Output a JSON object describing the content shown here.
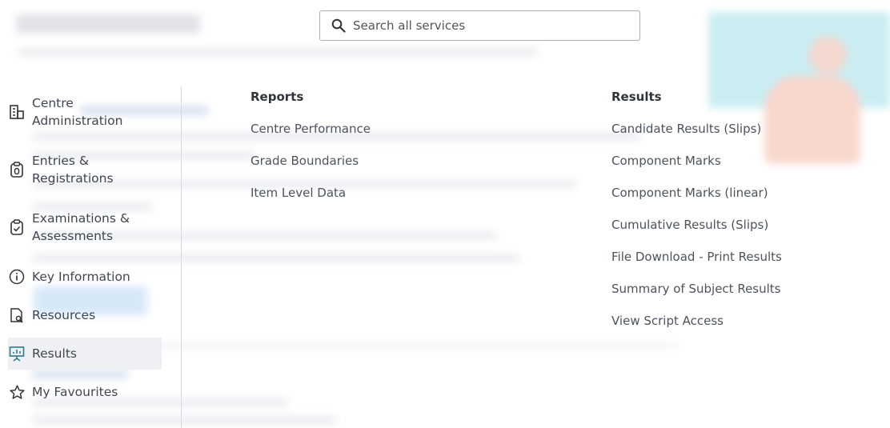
{
  "search": {
    "placeholder": "Search all services"
  },
  "sidebar": {
    "items": [
      {
        "label_line1": "Centre",
        "label_line2": "Administration",
        "icon": "building-icon"
      },
      {
        "label_line1": "Entries &",
        "label_line2": "Registrations",
        "icon": "clipboard-icon"
      },
      {
        "label_line1": "Examinations &",
        "label_line2": "Assessments",
        "icon": "clipboard-check-icon"
      },
      {
        "label": "Key Information",
        "icon": "info-icon"
      },
      {
        "label": "Resources",
        "icon": "document-search-icon"
      },
      {
        "label": "Results",
        "icon": "presentation-chart-icon",
        "active": true
      },
      {
        "label": "My Favourites",
        "icon": "star-icon"
      }
    ]
  },
  "columns": {
    "reports": {
      "title": "Reports",
      "links": [
        "Centre Performance",
        "Grade Boundaries",
        "Item Level Data"
      ]
    },
    "results": {
      "title": "Results",
      "links": [
        "Candidate Results (Slips)",
        "Component Marks",
        "Component Marks (linear)",
        "Cumulative Results (Slips)",
        "File Download - Print Results",
        "Summary of Subject Results",
        "View Script Access"
      ]
    }
  },
  "colors": {
    "accent_icon": "#2f7a8a",
    "active_bg": "#eef0f3",
    "divider": "#d6dbe0"
  }
}
